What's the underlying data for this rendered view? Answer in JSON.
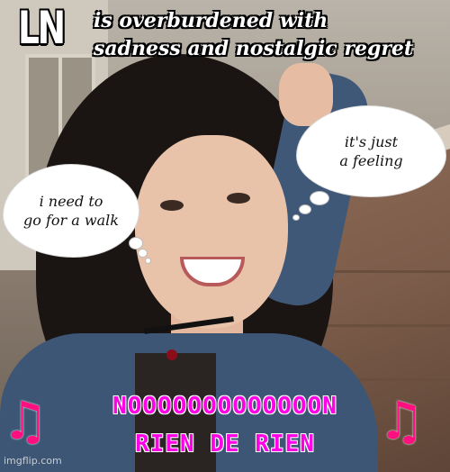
{
  "meme": {
    "corner_label": "LN",
    "headline_line1": "is overburdened with",
    "headline_line2": "sadness and nostalgic regret",
    "thought_right_line1": "it's just",
    "thought_right_line2": "a feeling",
    "thought_left_line1": "i need to",
    "thought_left_line2": "go for a walk",
    "caption_line1": "NOOOOOOOOOOOOON",
    "caption_line2": "RIEN DE RIEN",
    "left_note_icon": "music-note-icon",
    "right_note_icon": "music-note-icon",
    "watermark": "imgflip.com"
  },
  "colors": {
    "caption": "#ff00e6",
    "note": "#ff0f80"
  }
}
